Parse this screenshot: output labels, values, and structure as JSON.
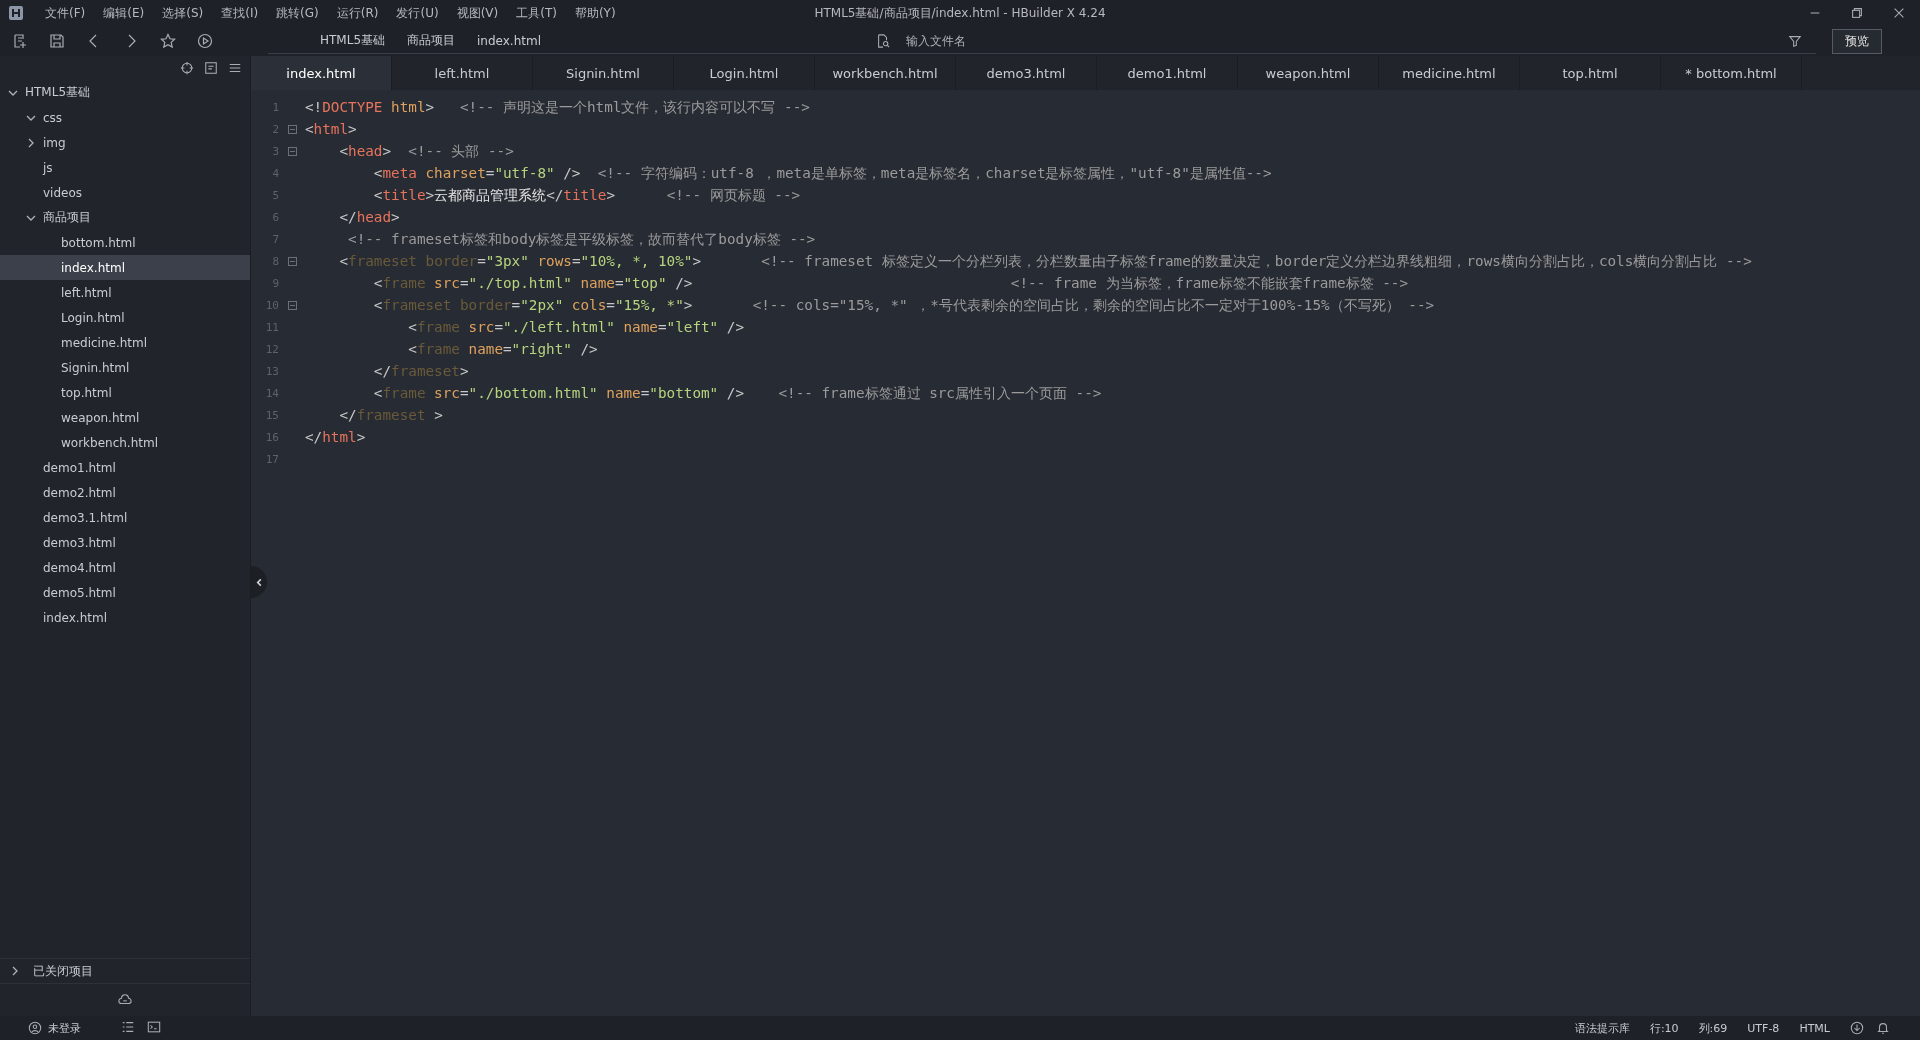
{
  "window": {
    "title": "HTML5基础/商品项目/index.html - HBuilder X 4.24"
  },
  "menu": [
    "文件(F)",
    "编辑(E)",
    "选择(S)",
    "查找(I)",
    "跳转(G)",
    "运行(R)",
    "发行(U)",
    "视图(V)",
    "工具(T)",
    "帮助(Y)"
  ],
  "breadcrumb": [
    "HTML5基础",
    "商品项目",
    "index.html"
  ],
  "search": {
    "placeholder": "输入文件名"
  },
  "preview_button": "预览",
  "tabs": [
    {
      "label": "index.html",
      "selected": true
    },
    {
      "label": "left.html",
      "selected": false
    },
    {
      "label": "Signin.html",
      "selected": false
    },
    {
      "label": "Login.html",
      "selected": false
    },
    {
      "label": "workbench.html",
      "selected": false
    },
    {
      "label": "demo3.html",
      "selected": false
    },
    {
      "label": "demo1.html",
      "selected": false
    },
    {
      "label": "weapon.html",
      "selected": false
    },
    {
      "label": "medicine.html",
      "selected": false
    },
    {
      "label": "top.html",
      "selected": false
    },
    {
      "label": "* bottom.html",
      "selected": false
    }
  ],
  "sidebar": {
    "tree": [
      {
        "label": "HTML5基础",
        "kind": "folder",
        "expanded": true,
        "selected": false,
        "children": [
          {
            "label": "css",
            "kind": "folder",
            "expanded": true,
            "selected": false
          },
          {
            "label": "img",
            "kind": "folder",
            "expanded": false,
            "selected": false
          },
          {
            "label": "js",
            "kind": "item",
            "selected": false
          },
          {
            "label": "videos",
            "kind": "item",
            "selected": false
          },
          {
            "label": "商品项目",
            "kind": "folder",
            "expanded": true,
            "selected": false,
            "children": [
              {
                "label": "bottom.html",
                "kind": "item",
                "selected": false
              },
              {
                "label": "index.html",
                "kind": "item",
                "selected": true
              },
              {
                "label": "left.html",
                "kind": "item",
                "selected": false
              },
              {
                "label": "Login.html",
                "kind": "item",
                "selected": false
              },
              {
                "label": "medicine.html",
                "kind": "item",
                "selected": false
              },
              {
                "label": "Signin.html",
                "kind": "item",
                "selected": false
              },
              {
                "label": "top.html",
                "kind": "item",
                "selected": false
              },
              {
                "label": "weapon.html",
                "kind": "item",
                "selected": false
              },
              {
                "label": "workbench.html",
                "kind": "item",
                "selected": false
              }
            ]
          },
          {
            "label": "demo1.html",
            "kind": "item",
            "selected": false
          },
          {
            "label": "demo2.html",
            "kind": "item",
            "selected": false
          },
          {
            "label": "demo3.1.html",
            "kind": "item",
            "selected": false
          },
          {
            "label": "demo3.html",
            "kind": "item",
            "selected": false
          },
          {
            "label": "demo4.html",
            "kind": "item",
            "selected": false
          },
          {
            "label": "demo5.html",
            "kind": "item",
            "selected": false
          },
          {
            "label": "index.html",
            "kind": "item",
            "selected": false
          }
        ]
      }
    ],
    "closed_projects": {
      "label": "已关闭项目",
      "expanded": false
    }
  },
  "editor": {
    "lines": [
      {
        "number": "1",
        "fold": false,
        "segments": [
          {
            "kind": "punct",
            "text": "<!"
          },
          {
            "kind": "tag",
            "text": "DOCTYPE"
          },
          {
            "kind": "attr",
            "text": " html"
          },
          {
            "kind": "punct",
            "text": ">"
          },
          {
            "kind": "comment",
            "text": "   <!-- 声明这是一个html文件，该行内容可以不写 -->"
          }
        ]
      },
      {
        "number": "2",
        "fold": true,
        "segments": [
          {
            "kind": "punct",
            "text": "<"
          },
          {
            "kind": "tag",
            "text": "html"
          },
          {
            "kind": "punct",
            "text": ">"
          }
        ]
      },
      {
        "number": "3",
        "fold": true,
        "segments": [
          {
            "kind": "punct",
            "text": "    <"
          },
          {
            "kind": "tag",
            "text": "head"
          },
          {
            "kind": "punct",
            "text": ">"
          },
          {
            "kind": "comment",
            "text": "  <!-- 头部 -->"
          }
        ]
      },
      {
        "number": "4",
        "fold": false,
        "segments": [
          {
            "kind": "punct",
            "text": "        <"
          },
          {
            "kind": "tag",
            "text": "meta"
          },
          {
            "kind": "attr",
            "text": " charset"
          },
          {
            "kind": "punct",
            "text": "="
          },
          {
            "kind": "string",
            "text": "\"utf-8\""
          },
          {
            "kind": "punct",
            "text": " />"
          },
          {
            "kind": "comment",
            "text": "  <!-- 字符编码：utf-8 ，meta是单标签，meta是标签名，charset是标签属性，\"utf-8\"是属性值-->"
          }
        ]
      },
      {
        "number": "5",
        "fold": false,
        "segments": [
          {
            "kind": "punct",
            "text": "        <"
          },
          {
            "kind": "tag",
            "text": "title"
          },
          {
            "kind": "punct",
            "text": ">"
          },
          {
            "kind": "text",
            "text": "云都商品管理系统"
          },
          {
            "kind": "punct",
            "text": "</"
          },
          {
            "kind": "tag",
            "text": "title"
          },
          {
            "kind": "punct",
            "text": ">"
          },
          {
            "kind": "comment",
            "text": "      <!-- 网页标题 -->"
          }
        ]
      },
      {
        "number": "6",
        "fold": false,
        "segments": [
          {
            "kind": "punct",
            "text": "    </"
          },
          {
            "kind": "tag",
            "text": "head"
          },
          {
            "kind": "punct",
            "text": ">"
          }
        ]
      },
      {
        "number": "7",
        "fold": false,
        "segments": [
          {
            "kind": "comment",
            "text": "     <!-- frameset标签和body标签是平级标签，故而替代了body标签 -->"
          }
        ]
      },
      {
        "number": "8",
        "fold": true,
        "segments": [
          {
            "kind": "punct",
            "text": "    <"
          },
          {
            "kind": "deprecated",
            "text": "frameset"
          },
          {
            "kind": "deprecated",
            "text": " border"
          },
          {
            "kind": "punct",
            "text": "="
          },
          {
            "kind": "string",
            "text": "\"3px\""
          },
          {
            "kind": "attr",
            "text": " rows"
          },
          {
            "kind": "punct",
            "text": "="
          },
          {
            "kind": "string",
            "text": "\"10%, *, 10%\""
          },
          {
            "kind": "punct",
            "text": ">"
          },
          {
            "kind": "comment",
            "text": "       <!-- frameset 标签定义一个分栏列表，分栏数量由子标签frame的数量决定，border定义分栏边界线粗细，rows横向分割占比，cols横向分割占比 -->"
          }
        ]
      },
      {
        "number": "9",
        "fold": false,
        "segments": [
          {
            "kind": "punct",
            "text": "        <"
          },
          {
            "kind": "deprecated",
            "text": "frame"
          },
          {
            "kind": "attr",
            "text": " src"
          },
          {
            "kind": "punct",
            "text": "="
          },
          {
            "kind": "string",
            "text": "\"./top.html\""
          },
          {
            "kind": "attr",
            "text": " name"
          },
          {
            "kind": "punct",
            "text": "="
          },
          {
            "kind": "string",
            "text": "\"top\""
          },
          {
            "kind": "punct",
            "text": " />"
          },
          {
            "kind": "comment",
            "text": "                                     <!-- frame 为当标签，frame标签不能嵌套frame标签 -->"
          }
        ]
      },
      {
        "number": "10",
        "fold": true,
        "segments": [
          {
            "kind": "punct",
            "text": "        <"
          },
          {
            "kind": "deprecated",
            "text": "frameset"
          },
          {
            "kind": "deprecated",
            "text": " border"
          },
          {
            "kind": "punct",
            "text": "="
          },
          {
            "kind": "string",
            "text": "\"2px\""
          },
          {
            "kind": "attr",
            "text": " cols"
          },
          {
            "kind": "punct",
            "text": "="
          },
          {
            "kind": "string",
            "text": "\"15%, *\""
          },
          {
            "kind": "punct",
            "text": ">"
          },
          {
            "kind": "comment",
            "text": "       <!-- cols=\"15%, *\" ，*号代表剩余的空间占比，剩余的空间占比不一定对于100%-15%（不写死） -->"
          }
        ]
      },
      {
        "number": "11",
        "fold": false,
        "segments": [
          {
            "kind": "punct",
            "text": "            <"
          },
          {
            "kind": "deprecated",
            "text": "frame"
          },
          {
            "kind": "attr",
            "text": " src"
          },
          {
            "kind": "punct",
            "text": "="
          },
          {
            "kind": "string",
            "text": "\"./left.html\""
          },
          {
            "kind": "attr",
            "text": " name"
          },
          {
            "kind": "punct",
            "text": "="
          },
          {
            "kind": "string",
            "text": "\"left\""
          },
          {
            "kind": "punct",
            "text": " />"
          }
        ]
      },
      {
        "number": "12",
        "fold": false,
        "segments": [
          {
            "kind": "punct",
            "text": "            <"
          },
          {
            "kind": "deprecated",
            "text": "frame"
          },
          {
            "kind": "attr",
            "text": " name"
          },
          {
            "kind": "punct",
            "text": "="
          },
          {
            "kind": "string",
            "text": "\"right\""
          },
          {
            "kind": "punct",
            "text": " />"
          }
        ]
      },
      {
        "number": "13",
        "fold": false,
        "segments": [
          {
            "kind": "punct",
            "text": "        </"
          },
          {
            "kind": "deprecated",
            "text": "frameset"
          },
          {
            "kind": "punct",
            "text": ">"
          }
        ]
      },
      {
        "number": "14",
        "fold": false,
        "segments": [
          {
            "kind": "punct",
            "text": "        <"
          },
          {
            "kind": "deprecated",
            "text": "frame"
          },
          {
            "kind": "attr",
            "text": " src"
          },
          {
            "kind": "punct",
            "text": "="
          },
          {
            "kind": "string",
            "text": "\"./bottom.html\""
          },
          {
            "kind": "attr",
            "text": " name"
          },
          {
            "kind": "punct",
            "text": "="
          },
          {
            "kind": "string",
            "text": "\"bottom\""
          },
          {
            "kind": "punct",
            "text": " />"
          },
          {
            "kind": "comment",
            "text": "    <!-- frame标签通过 src属性引入一个页面 -->"
          }
        ]
      },
      {
        "number": "15",
        "fold": false,
        "segments": [
          {
            "kind": "punct",
            "text": "    </"
          },
          {
            "kind": "deprecated",
            "text": "frameset"
          },
          {
            "kind": "punct",
            "text": " >"
          }
        ]
      },
      {
        "number": "16",
        "fold": false,
        "segments": [
          {
            "kind": "punct",
            "text": "</"
          },
          {
            "kind": "tag",
            "text": "html"
          },
          {
            "kind": "punct",
            "text": ">"
          }
        ]
      },
      {
        "number": "17",
        "fold": false
      }
    ]
  },
  "status_bar": {
    "user": "未登录",
    "items": [
      "语法提示库",
      "行:10",
      "列:69",
      "UTF-8",
      "HTML"
    ]
  }
}
